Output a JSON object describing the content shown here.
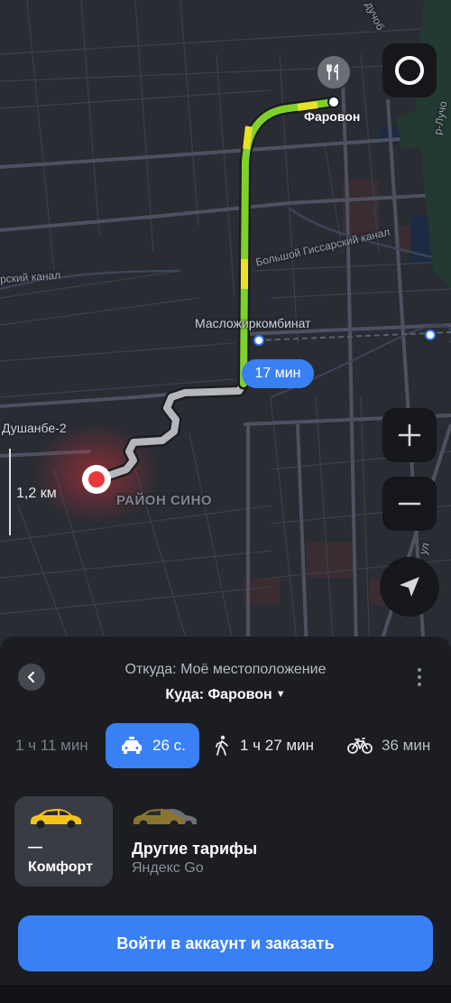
{
  "map": {
    "labels": {
      "destination": "Фаровон",
      "station": "Масложиркомбинат",
      "city_station": "Душанбе-2",
      "district": "РАЙОН СИНО",
      "canal_left": "рский канал",
      "canal_right": "Большой Гиссарский канал",
      "edge_top": "дучоб",
      "edge_right_top": "р-Лучо",
      "edge_right_mid": "ул"
    },
    "eta_badge": "17 мин",
    "scale_label": "1,2 км",
    "buttons": {
      "alice_icon": "alice-icon",
      "zoom_in_icon": "plus-icon",
      "zoom_out_icon": "minus-icon",
      "locate_icon": "navigation-arrow-icon"
    },
    "poi_icon": "restaurant-icon"
  },
  "sheet": {
    "from_text": "Откуда: Моё местоположение",
    "to_text": "Куда: Фаровон",
    "to_caret": "▼",
    "modes": [
      {
        "id": "car",
        "label": "1 ч 11 мин",
        "icon": "car-icon"
      },
      {
        "id": "taxi",
        "label": "26 с.",
        "icon": "taxi-icon",
        "active": true
      },
      {
        "id": "walk",
        "label": "1 ч 27 мин",
        "icon": "walk-icon"
      },
      {
        "id": "bike",
        "label": "36 мин",
        "icon": "bike-icon"
      }
    ],
    "tariff": {
      "price": "—",
      "name": "Комфорт"
    },
    "other_tariffs": {
      "title": "Другие тарифы",
      "subtitle": "Яндекс Go"
    },
    "order_button": "Войти в аккаунт и заказать"
  },
  "colors": {
    "accent": "#3a80f5",
    "route_green": "#7fd12a",
    "route_yellow": "#e8e327",
    "route_gray": "#b5b7bc",
    "location_dot": "#e63a3a"
  }
}
